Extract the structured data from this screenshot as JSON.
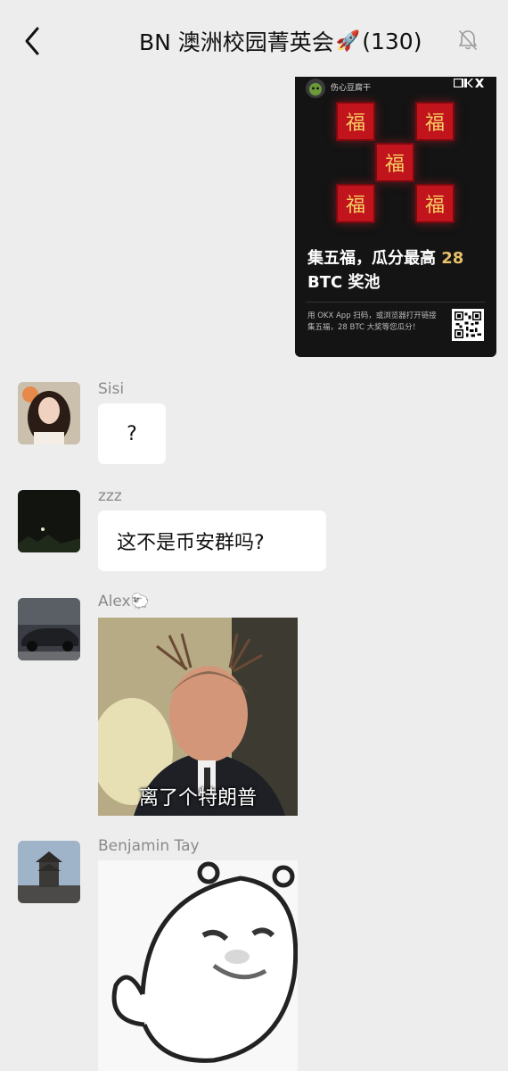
{
  "header": {
    "back_icon": "chevron-left-icon",
    "title": "BN 澳洲校园菁英会",
    "title_emoji": "🚀",
    "member_count": "(130)",
    "mute_icon": "bell-muted-icon"
  },
  "okx_card": {
    "account_name": "伤心豆腐干",
    "brand": "OKX",
    "fu_character": "福",
    "headline_pre": "集五福，瓜分最高 ",
    "headline_highlight_1": "28",
    "headline_mid": "BTC",
    "headline_post": " 奖池",
    "footer_text": "用 OKX App 扫码，或浏览器打开链接集五福，28 BTC 大奖等您瓜分！",
    "accent_red": "#c2141d",
    "accent_gold": "#e8c16a"
  },
  "messages": [
    {
      "sender": "Sisi",
      "type": "text",
      "text": "?"
    },
    {
      "sender": "zzz",
      "type": "text",
      "text": "这不是币安群吗?"
    },
    {
      "sender": "Alex🐑",
      "type": "sticker",
      "caption": "离了个特朗普"
    },
    {
      "sender": "Benjamin Tay",
      "type": "sticker",
      "caption": ""
    }
  ],
  "colors": {
    "background": "#ededed",
    "bubble": "#ffffff",
    "sender_name": "#8a8a8a"
  }
}
